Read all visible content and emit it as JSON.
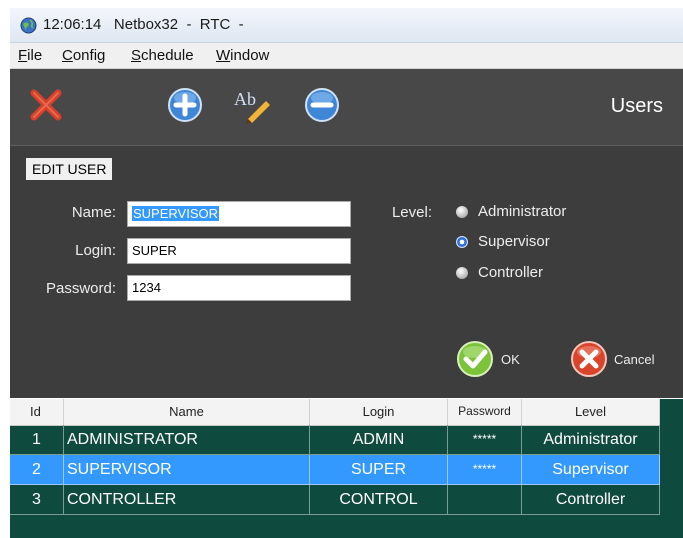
{
  "window": {
    "title": "12:06:14   Netbox32  -  RTC  -"
  },
  "menu": {
    "items": [
      {
        "mnemonic": "F",
        "rest": "ile"
      },
      {
        "mnemonic": "C",
        "rest": "onfig"
      },
      {
        "mnemonic": "S",
        "rest": "chedule"
      },
      {
        "mnemonic": "W",
        "rest": "indow"
      }
    ]
  },
  "toolbar": {
    "title": "Users",
    "buttons": [
      {
        "icon": "close-icon"
      },
      {
        "icon": "add-icon"
      },
      {
        "icon": "edit-icon",
        "glyph": "Ab"
      },
      {
        "icon": "remove-icon"
      }
    ]
  },
  "edit_user": {
    "heading": "EDIT USER",
    "name_label": "Name:",
    "name_value": "SUPERVISOR",
    "login_label": "Login:",
    "login_value": "SUPER",
    "password_label": "Password:",
    "password_value": "1234",
    "level_label": "Level:",
    "levels": [
      {
        "label": "Administrator",
        "checked": false
      },
      {
        "label": "Supervisor",
        "checked": true
      },
      {
        "label": "Controller",
        "checked": false
      }
    ],
    "ok_label": "OK",
    "cancel_label": "Cancel"
  },
  "table": {
    "columns": [
      "Id",
      "Name",
      "Login",
      "Password",
      "Level"
    ],
    "rows": [
      {
        "id": "1",
        "name": "ADMINISTRATOR",
        "login": "ADMIN",
        "password": "*****",
        "level": "Administrator",
        "selected": false
      },
      {
        "id": "2",
        "name": "SUPERVISOR",
        "login": "SUPER",
        "password": "*****",
        "level": "Supervisor",
        "selected": true
      },
      {
        "id": "3",
        "name": "CONTROLLER",
        "login": "CONTROL",
        "password": "",
        "level": "Controller",
        "selected": false
      }
    ]
  },
  "colors": {
    "toolbar_bg": "#484848",
    "panel_bg": "#3d3d3d",
    "grid_bg": "#0f4a3f",
    "row_bg": "#0f4a3f",
    "selected_row_bg": "#3399ff",
    "selection_highlight": "#3399ff"
  }
}
